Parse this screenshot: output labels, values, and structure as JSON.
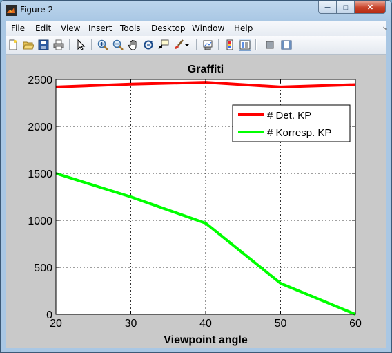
{
  "window": {
    "title": "Figure 2",
    "min_symbol": "─",
    "max_symbol": "□",
    "close_symbol": "✕"
  },
  "menu": {
    "items": [
      "File",
      "Edit",
      "View",
      "Insert",
      "Tools",
      "Desktop",
      "Window",
      "Help"
    ],
    "dock_arrow": "↘"
  },
  "toolbar": {
    "icons": [
      "new-figure-icon",
      "open-file-icon",
      "save-icon",
      "print-icon",
      "edit-plot-icon",
      "zoom-in-icon",
      "zoom-out-icon",
      "pan-icon",
      "rotate-3d-icon",
      "data-cursor-icon",
      "brush-icon",
      "brush-dropdown-icon",
      "link-plot-icon",
      "insert-colorbar-icon",
      "insert-legend-icon",
      "hide-plot-tools-icon",
      "show-plot-tools-icon"
    ]
  },
  "colors": {
    "det_line": "#ff0000",
    "korr_line": "#00ff00",
    "figure_bg": "#c9c9c9"
  },
  "chart_data": {
    "type": "line",
    "title": "Graffiti",
    "xlabel": "Viewpoint angle",
    "ylabel": "",
    "xlim": [
      20,
      60
    ],
    "ylim": [
      0,
      2500
    ],
    "xticks": [
      20,
      30,
      40,
      50,
      60
    ],
    "yticks": [
      0,
      500,
      1000,
      1500,
      2000,
      2500
    ],
    "grid": true,
    "legend_position": "top-right",
    "series": [
      {
        "name": "# Det. KP",
        "color": "#ff0000",
        "x": [
          20,
          30,
          40,
          50,
          60
        ],
        "y": [
          2420,
          2450,
          2470,
          2420,
          2445
        ]
      },
      {
        "name": "# Korresp. KP",
        "color": "#00ff00",
        "x": [
          20,
          30,
          40,
          50,
          60
        ],
        "y": [
          1500,
          1250,
          970,
          330,
          0
        ]
      }
    ]
  }
}
